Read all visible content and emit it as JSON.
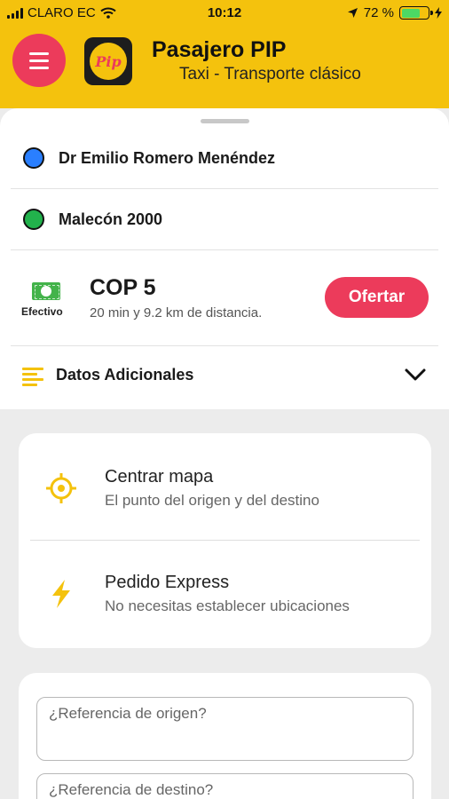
{
  "status_bar": {
    "carrier": "CLARO EC",
    "time": "10:12",
    "battery": "72 %",
    "battery_level": 0.72
  },
  "header": {
    "menu_icon": "hamburger-menu-icon",
    "logo_text": "Pip",
    "title": "Pasajero PIP",
    "subtitle": "Taxi - Transporte clásico"
  },
  "trip": {
    "origin": "Dr Emilio Romero Menéndez",
    "destination": "Malecón 2000",
    "origin_color": "#2a7fff",
    "destination_color": "#22b24c",
    "payment_label": "Efectivo",
    "price": "COP 5",
    "info": "20 min y 9.2 km de distancia.",
    "offer_button": "Ofertar",
    "extra_label": "Datos Adicionales"
  },
  "options": [
    {
      "icon": "crosshair-icon",
      "title": "Centrar mapa",
      "subtitle": "El punto del origen y del destino"
    },
    {
      "icon": "lightning-bolt-icon",
      "title": "Pedido Express",
      "subtitle": "No necesitas establecer ubicaciones"
    }
  ],
  "references": {
    "origin_placeholder": "¿Referencia de origen?",
    "destination_placeholder": "¿Referencia de destino?"
  },
  "colors": {
    "brand_yellow": "#f4c20d",
    "accent_pink": "#ec3b5b",
    "cash_green": "#43b34a"
  }
}
